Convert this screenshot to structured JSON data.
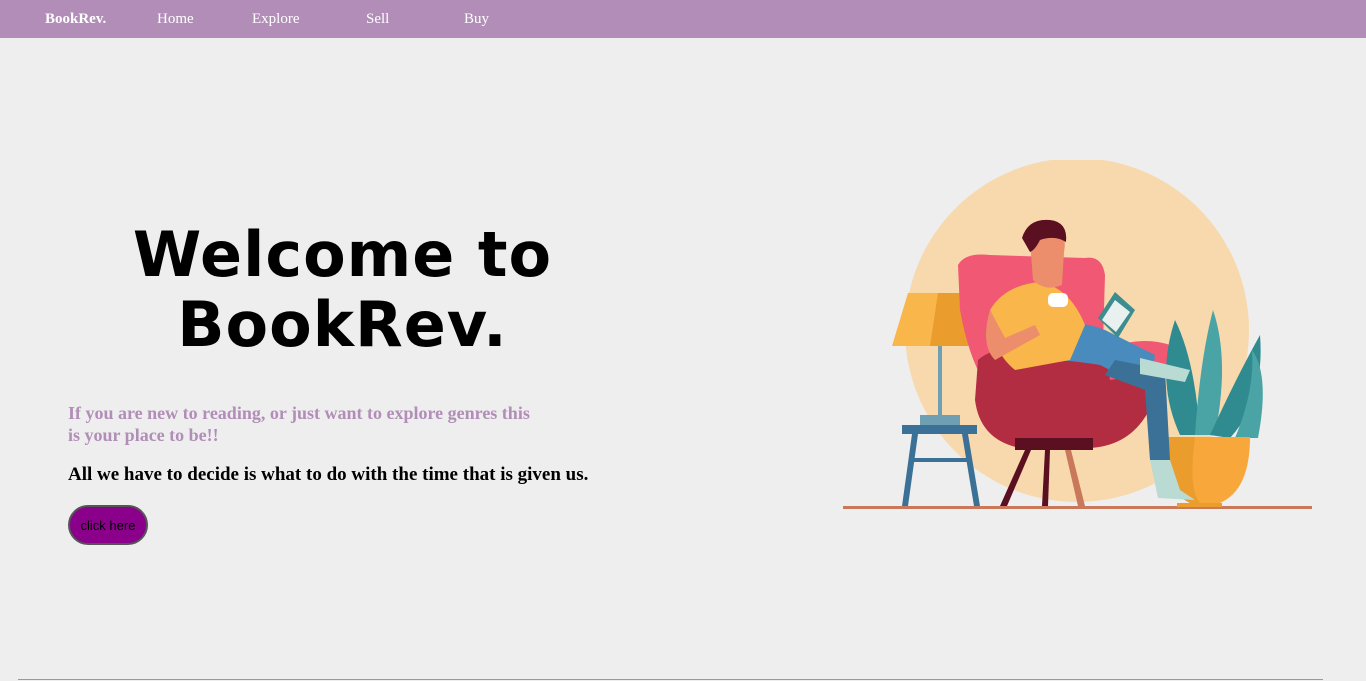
{
  "nav": {
    "brand": "BookRev.",
    "items": [
      "Home",
      "Explore",
      "Sell",
      "Buy"
    ]
  },
  "hero": {
    "title": "Welcome to BookRev.",
    "subtitle": "If you are new to reading, or just want to explore genres this is your place to be!!",
    "quote": "All we have to decide is what to do with the time that is given us.",
    "button_label": "click here"
  },
  "colors": {
    "navbar": "#b18db8",
    "accent": "#b18db8",
    "button": "#8b008b",
    "background": "#eeeeee"
  }
}
